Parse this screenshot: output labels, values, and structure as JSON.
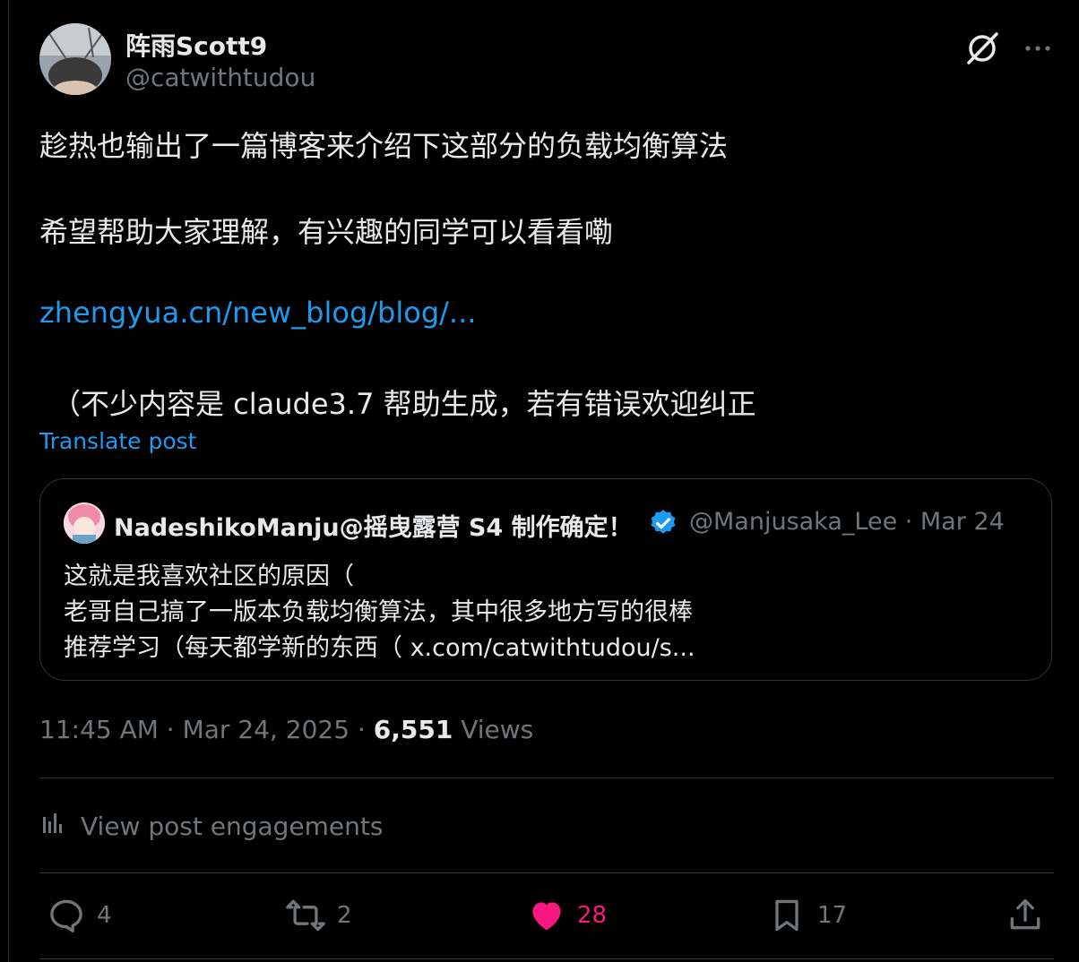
{
  "author": {
    "name": "阵雨Scott9",
    "handle": "@catwithtudou"
  },
  "post": {
    "line1": "趁热也输出了一篇博客来介绍下这部分的负载均衡算法",
    "line2": "希望帮助大家理解，有兴趣的同学可以看看嘞",
    "link": "zhengyua.cn/new_blog/blog/...",
    "line3": "（不少内容是 claude3.7 帮助生成，若有错误欢迎纠正",
    "translate_label": "Translate post"
  },
  "quote": {
    "name": "NadeshikoManju@摇曳露营 S4 制作确定！",
    "handle_date": "@Manjusaka_Lee · Mar 24",
    "line1": "这就是我喜欢社区的原因（",
    "line2": "老哥自己搞了一版本负载均衡算法，其中很多地方写的很棒",
    "line3": "推荐学习（每天都学新的东西（ x.com/catwithtudou/s..."
  },
  "meta": {
    "timestamp": "11:45 AM · Mar 24, 2025 · ",
    "views_count": "6,551",
    "views_label": " Views"
  },
  "engagements_label": "View post engagements",
  "actions": {
    "replies": "4",
    "reposts": "2",
    "likes": "28",
    "bookmarks": "17"
  },
  "colors": {
    "accent": "#1d9bf0",
    "like": "#f91880",
    "muted": "#71767b",
    "text": "#e7e9ea",
    "border": "#2f3336"
  },
  "icons": [
    "grok-icon",
    "more-icon",
    "verified-icon",
    "engagements-icon",
    "reply-icon",
    "repost-icon",
    "like-icon",
    "bookmark-icon",
    "share-icon"
  ]
}
